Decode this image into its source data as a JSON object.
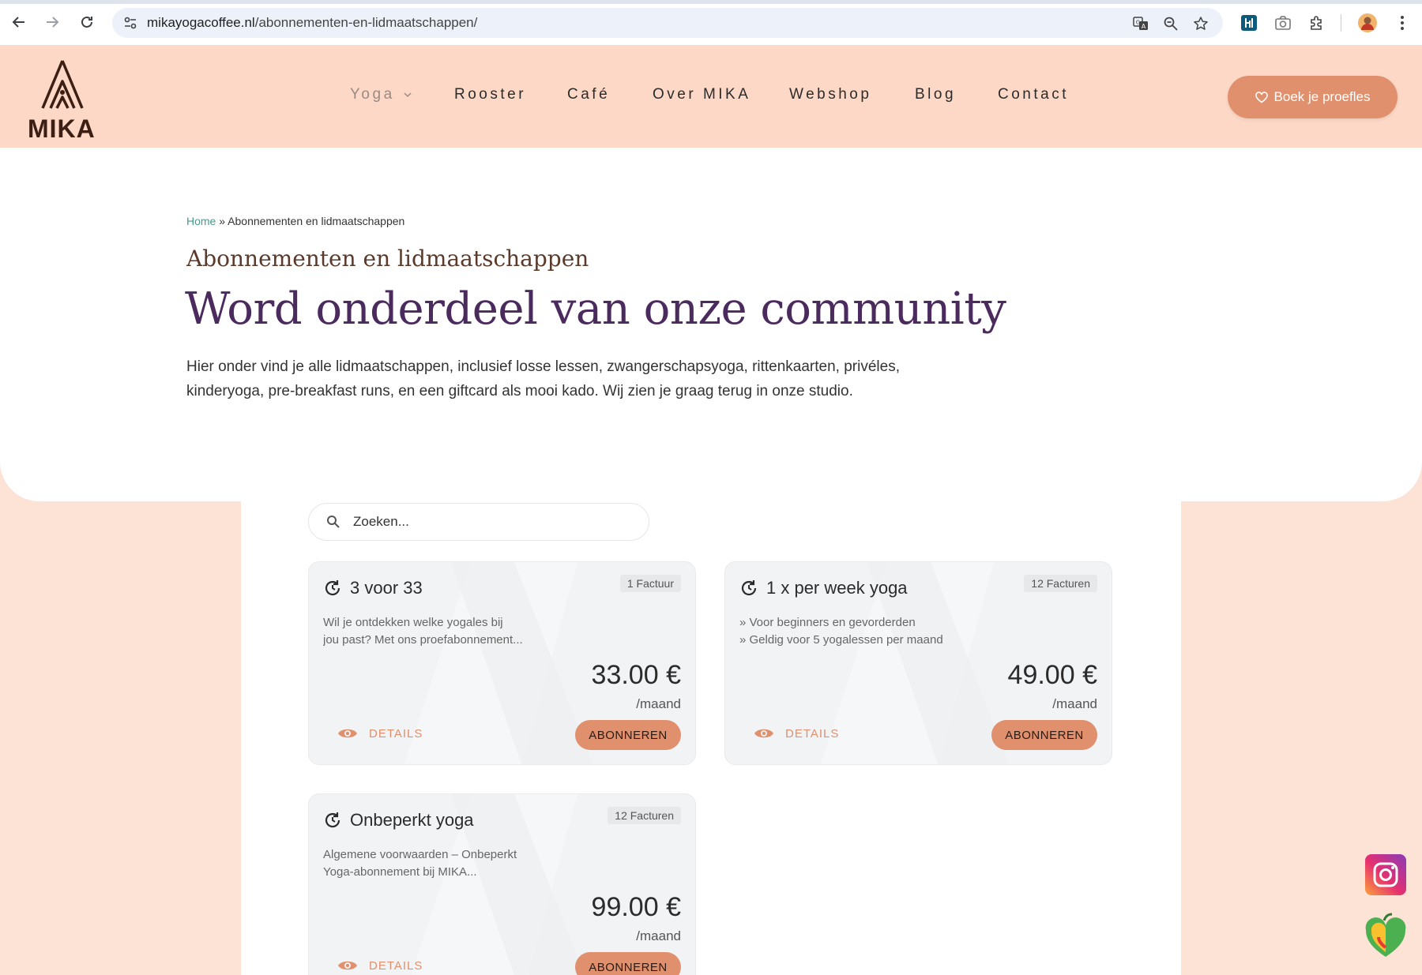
{
  "browser": {
    "url_host": "mikayogacoffee.nl",
    "url_path": "/abonnementen-en-lidmaatschappen/",
    "icons": [
      "back-icon",
      "forward-icon",
      "reload-icon",
      "tune-icon",
      "translate-icon",
      "zoom-icon",
      "star-icon",
      "extension-h-icon",
      "camera-icon",
      "puzzle-icon",
      "avatar",
      "kebab-menu-icon"
    ]
  },
  "header": {
    "logo_text": "MIKA",
    "menu": [
      {
        "label": "Yoga",
        "has_dropdown": true
      },
      {
        "label": "Rooster"
      },
      {
        "label": "Café"
      },
      {
        "label": "Over MIKA"
      },
      {
        "label": "Webshop"
      },
      {
        "label": "Blog"
      },
      {
        "label": "Contact"
      }
    ],
    "cta_label": "Boek je proefles"
  },
  "hero": {
    "breadcrumb_home": "Home",
    "breadcrumb_sep": " » ",
    "breadcrumb_current": "Abonnementen en lidmaatschappen",
    "subtitle": "Abonnementen en lidmaatschappen",
    "headline": "Word onderdeel van onze community",
    "intro": "Hier onder vind je alle lidmaatschappen, inclusief losse lessen, zwangerschapsyoga, rittenkaarten, privéles, kinderyoga, pre-breakfast runs, en een giftcard als mooi kado. Wij zien je graag terug in onze studio."
  },
  "search": {
    "placeholder": "Zoeken..."
  },
  "cards": [
    {
      "title": "3 voor 33",
      "badge": "1 Factuur",
      "desc": [
        "Wil je ontdekken welke yogales bij",
        "jou past? Met ons proefabonnement..."
      ],
      "price": "33.00 €",
      "period": "/maand",
      "details_label": "DETAILS",
      "subscribe_label": "ABONNEREN"
    },
    {
      "title": "1 x per week yoga",
      "badge": "12 Facturen",
      "desc": [
        "» Voor beginners en gevorderden",
        "» Geldig voor 5 yogalessen per maand"
      ],
      "price": "49.00 €",
      "period": "/maand",
      "details_label": "DETAILS",
      "subscribe_label": "ABONNEREN"
    },
    {
      "title": "Onbeperkt yoga",
      "badge": "12 Facturen",
      "desc": [
        "Algemene voorwaarden – Onbeperkt",
        "Yoga-abonnement bij MIKA..."
      ],
      "price": "99.00 €",
      "period": "/maand",
      "details_label": "DETAILS",
      "subscribe_label": "ABONNEREN"
    }
  ],
  "colors": {
    "header_bg": "#fdd8c6",
    "accent": "#e0906d",
    "headline": "#4b2a5e"
  }
}
